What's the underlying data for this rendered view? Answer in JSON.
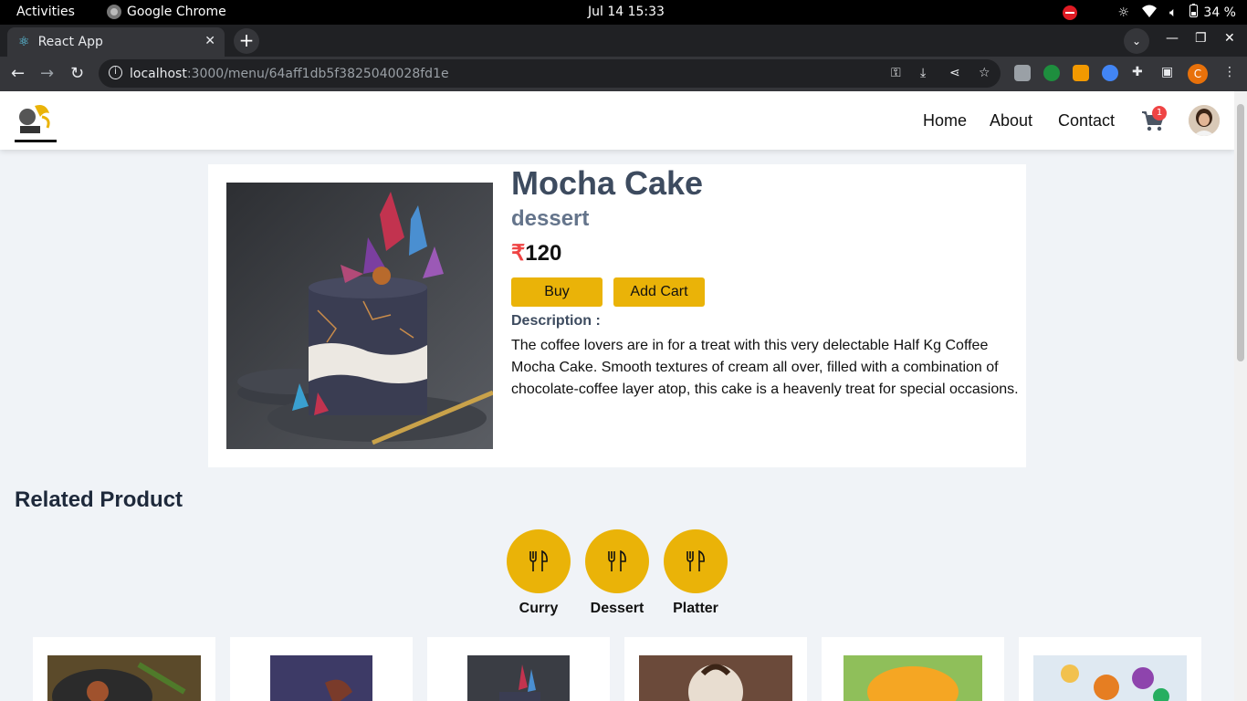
{
  "system": {
    "activities": "Activities",
    "app_name": "Google Chrome",
    "clock": "Jul 14  15:33",
    "battery": "34 %"
  },
  "browser": {
    "tab_title": "React App",
    "url_host": "localhost",
    "url_rest": ":3000/menu/64aff1db5f3825040028fd1e",
    "profile_initial": "C"
  },
  "app": {
    "nav": {
      "home": "Home",
      "about": "About",
      "contact": "Contact"
    },
    "cart_count": "1"
  },
  "product": {
    "name": "Mocha Cake",
    "category": "dessert",
    "currency": "₹",
    "price": "120",
    "buy_label": "Buy",
    "add_cart_label": "Add Cart",
    "description_label": "Description :",
    "description": "The coffee lovers are in for a treat with this very delectable Half Kg Coffee Mocha Cake. Smooth textures of cream all over, filled with a combination of chocolate-coffee layer atop, this cake is a heavenly treat for special occasions."
  },
  "related": {
    "title": "Related Product",
    "categories": [
      {
        "label": "Curry",
        "icon": "fork-knife-icon"
      },
      {
        "label": "Dessert",
        "icon": "fork-knife-icon"
      },
      {
        "label": "Platter",
        "icon": "fork-knife-icon"
      }
    ]
  },
  "colors": {
    "accent": "#eab308",
    "badge": "#ef4444",
    "title": "#3d4b5f",
    "page_bg": "#f0f3f7"
  }
}
